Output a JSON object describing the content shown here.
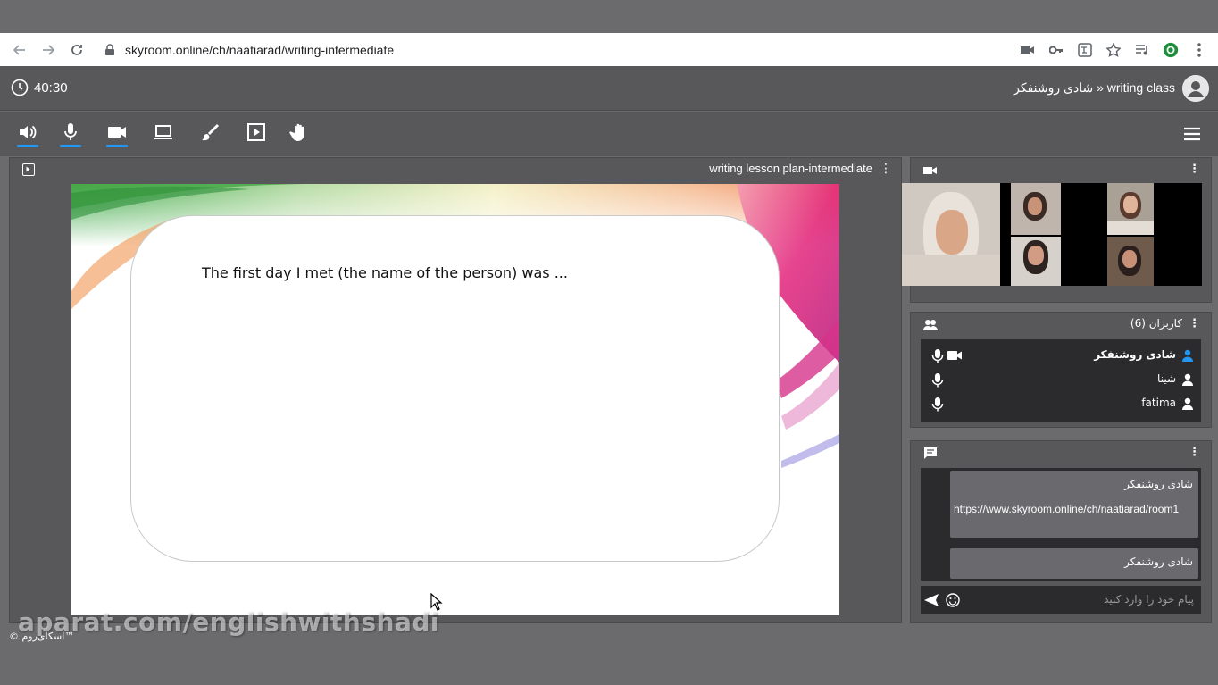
{
  "browser": {
    "url": "skyroom.online/ch/naatiarad/writing-intermediate"
  },
  "header": {
    "timer": "40:30",
    "room_title": "شادی روشنفکر » writing class"
  },
  "toolbar": {
    "active_color": "#2196f3",
    "tools": [
      "speaker-icon",
      "microphone-icon",
      "camera-icon",
      "screen-share-icon",
      "brush-icon",
      "media-play-icon",
      "raise-hand-icon"
    ]
  },
  "presentation": {
    "name": "writing lesson plan-intermediate",
    "slide_text": "The first day I met (the name of the person) was ..."
  },
  "users": {
    "title": "کاربران (6)",
    "list": [
      {
        "name": "شادی روشنفکر",
        "mic": true,
        "camera": true,
        "bold": true,
        "highlight_color": "#2196f3"
      },
      {
        "name": "شینا",
        "mic": true,
        "camera": false,
        "bold": false
      },
      {
        "name": "fatima",
        "mic": true,
        "camera": false,
        "bold": false
      }
    ]
  },
  "chat": {
    "messages": [
      {
        "author": "شادی روشنفکر",
        "text": "https://www.skyroom.online/ch/naatiarad/room1"
      },
      {
        "author": "شادی روشنفکر",
        "text": ""
      }
    ],
    "placeholder": "پیام خود را وارد کنید"
  },
  "footer": {
    "copyright": "© اسکای‌روم™",
    "watermark": "aparat.com/englishwithshadi"
  }
}
